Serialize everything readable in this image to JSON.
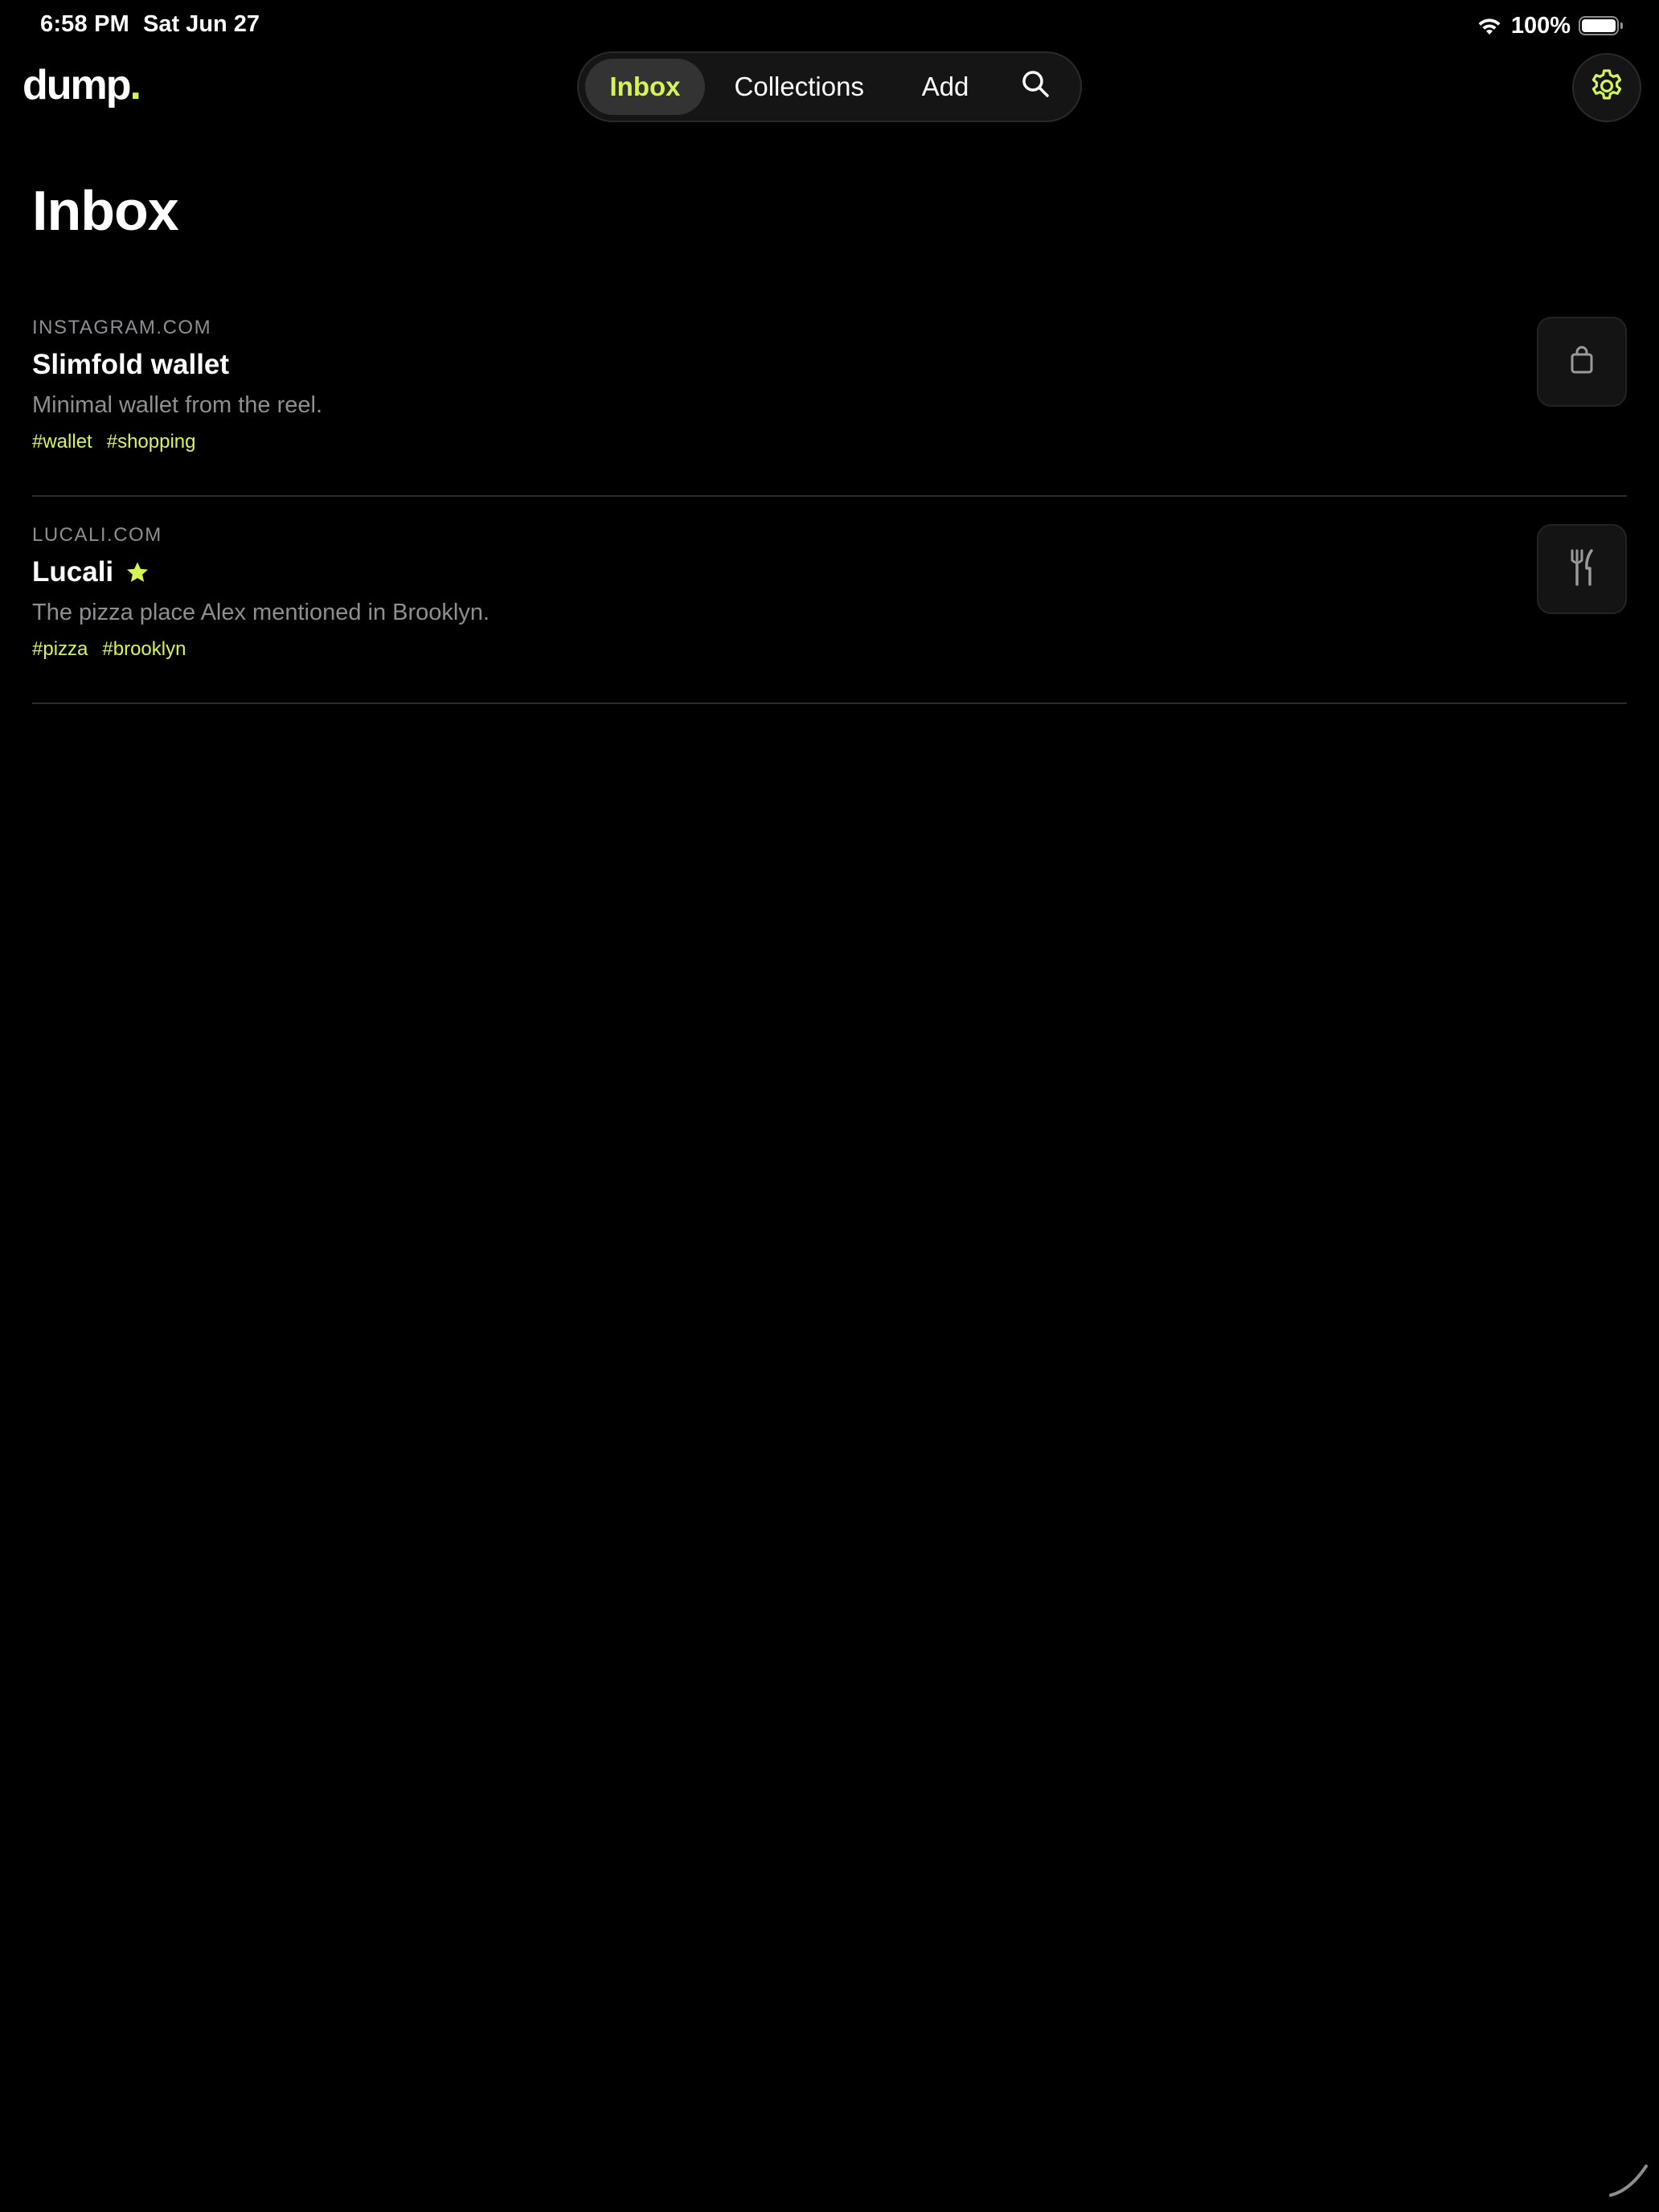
{
  "status_bar": {
    "time": "6:58 PM",
    "date": "Sat Jun 27",
    "battery": "100%",
    "wifi_icon": "wifi-icon",
    "battery_icon": "battery-icon"
  },
  "header": {
    "logo_text": "dump",
    "logo_dot": ".",
    "nav": {
      "inbox": "Inbox",
      "collections": "Collections",
      "add": "Add",
      "search_icon": "search-icon"
    },
    "settings_icon": "gear-icon"
  },
  "page": {
    "title": "Inbox"
  },
  "items": [
    {
      "source": "INSTAGRAM.COM",
      "title": "Slimfold wallet",
      "starred": false,
      "description": "Minimal wallet from the reel.",
      "tags": [
        "#wallet",
        "#shopping"
      ],
      "thumb_icon": "shopping-bag-icon"
    },
    {
      "source": "LUCALI.COM",
      "title": "Lucali",
      "starred": true,
      "description": "The pizza place Alex mentioned in Brooklyn.",
      "tags": [
        "#pizza",
        "#brooklyn"
      ],
      "thumb_icon": "fork-knife-icon"
    }
  ],
  "colors": {
    "background": "#000000",
    "accent": "#d4f55a",
    "muted_text": "#8e8e93",
    "divider": "#2c2c2c"
  }
}
